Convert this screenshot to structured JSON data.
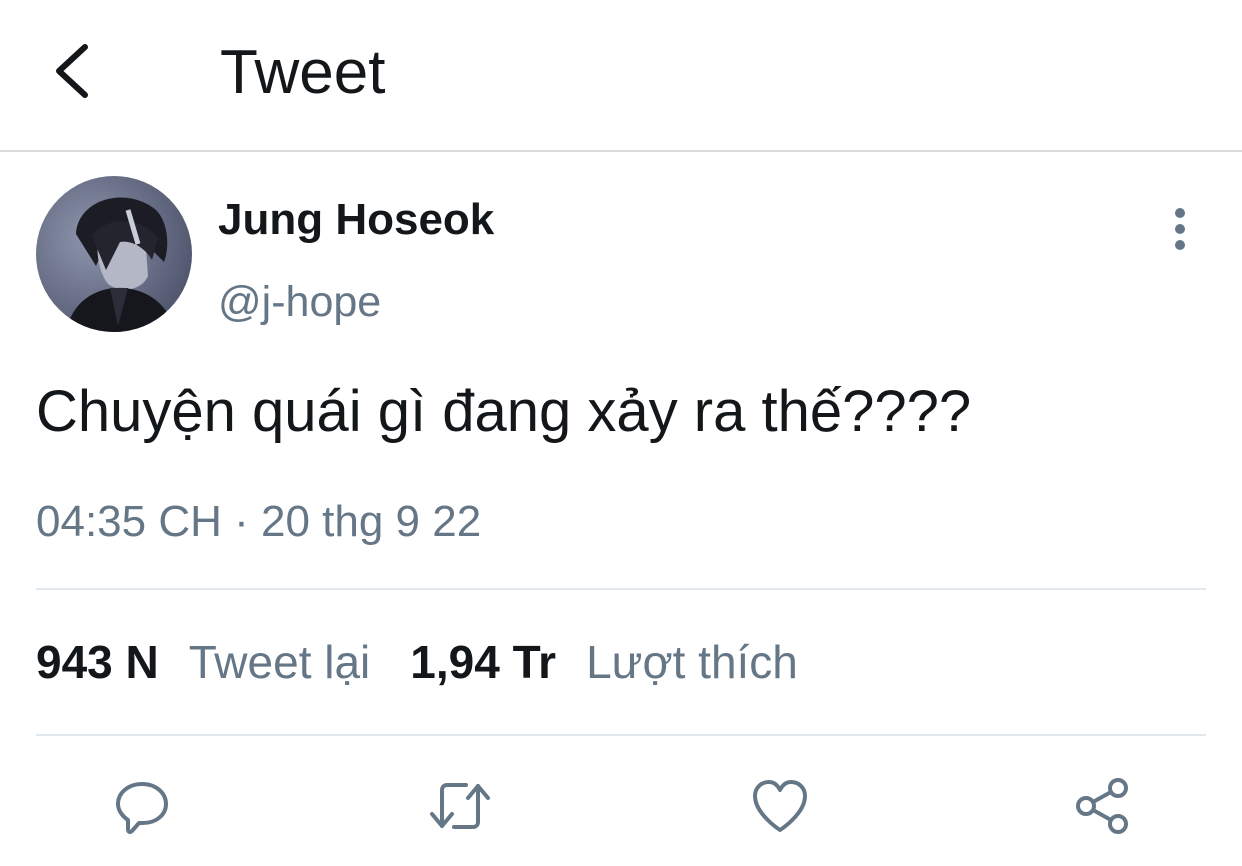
{
  "header": {
    "title": "Tweet",
    "back_icon": "chevron-left-icon"
  },
  "tweet": {
    "display_name": "Jung Hoseok",
    "handle": "@j-hope",
    "text": "Chuyện quái gì đang xảy ra thế????",
    "timestamp": "04:35 CH · 20 thg 9 22",
    "more_icon": "more-vertical-icon"
  },
  "stats": {
    "retweets_count": "943 N",
    "retweets_label": "Tweet lại",
    "likes_count": "1,94 Tr",
    "likes_label": "Lượt thích"
  },
  "actions": [
    {
      "name": "reply",
      "icon": "comment-icon"
    },
    {
      "name": "retweet",
      "icon": "retweet-icon"
    },
    {
      "name": "like",
      "icon": "heart-icon"
    },
    {
      "name": "share",
      "icon": "share-icon"
    }
  ],
  "colors": {
    "text_primary": "#14171a",
    "text_secondary": "#657786",
    "divider": "#e1e8ed",
    "icon": "#657786"
  }
}
